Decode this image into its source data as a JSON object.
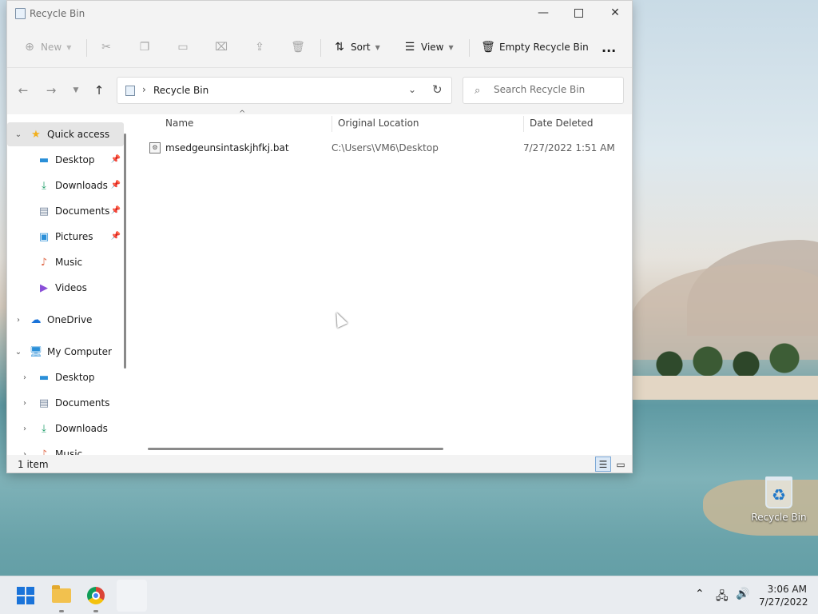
{
  "window": {
    "title": "Recycle Bin"
  },
  "toolbar": {
    "new_label": "New",
    "sort_label": "Sort",
    "view_label": "View",
    "empty_label": "Empty Recycle Bin",
    "more_label": "..."
  },
  "address": {
    "path": "Recycle Bin"
  },
  "search": {
    "placeholder": "Search Recycle Bin"
  },
  "sidebar": {
    "items": [
      {
        "label": "Quick access",
        "icon": "star-icon"
      },
      {
        "label": "Desktop",
        "icon": "desktop-icon"
      },
      {
        "label": "Downloads",
        "icon": "download-icon"
      },
      {
        "label": "Documents",
        "icon": "document-icon"
      },
      {
        "label": "Pictures",
        "icon": "picture-icon"
      },
      {
        "label": "Music",
        "icon": "music-icon"
      },
      {
        "label": "Videos",
        "icon": "video-icon"
      },
      {
        "label": "OneDrive",
        "icon": "cloud-icon"
      },
      {
        "label": "My Computer",
        "icon": "computer-icon"
      },
      {
        "label": "Desktop",
        "icon": "desktop-icon"
      },
      {
        "label": "Documents",
        "icon": "document-icon"
      },
      {
        "label": "Downloads",
        "icon": "download-icon"
      },
      {
        "label": "Music",
        "icon": "music-icon"
      }
    ]
  },
  "columns": {
    "name": "Name",
    "location": "Original Location",
    "date": "Date Deleted"
  },
  "files": [
    {
      "name": "msedgeunsintaskjhfkj.bat",
      "location": "C:\\Users\\VM6\\Desktop",
      "date": "7/27/2022 1:51 AM"
    }
  ],
  "status": {
    "count": "1 item"
  },
  "desktop": {
    "recycle_label": "Recycle Bin"
  },
  "clock": {
    "time": "3:06 AM",
    "date": "7/27/2022"
  },
  "colors": {
    "accent": "#1a73d9",
    "selection": "#e5e5e5"
  }
}
